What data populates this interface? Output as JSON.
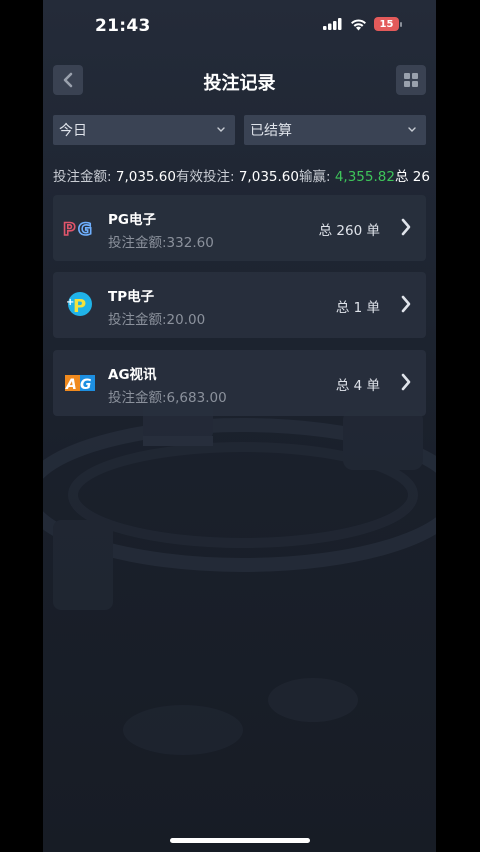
{
  "status_bar": {
    "time": "21:43",
    "battery_level": "15",
    "icons": [
      "cellular-signal-icon",
      "wifi-icon",
      "battery-icon"
    ]
  },
  "header": {
    "title": "投注记录",
    "back_icon": "chevron-left-icon",
    "menu_icon": "grid-icon"
  },
  "filters": {
    "date": {
      "value": "今日"
    },
    "status": {
      "value": "已结算"
    }
  },
  "summary": {
    "bet_label": "投注金额:",
    "bet_value": "7,035.60",
    "valid_label": "有效投注:",
    "valid_value": "7,035.60",
    "winloss_label": "输赢:",
    "winloss_value": "4,355.82",
    "total_label": "总 26"
  },
  "records": [
    {
      "name": "PG电子",
      "amount": "投注金额:332.60",
      "count": "总 260 单",
      "logo": "pg-logo-icon"
    },
    {
      "name": "TP电子",
      "amount": "投注金额:20.00",
      "count": "总 1 单",
      "logo": "tp-logo-icon"
    },
    {
      "name": "AG视讯",
      "amount": "投注金额:6,683.00",
      "count": "总 4 单",
      "logo": "ag-logo-icon"
    }
  ],
  "colors": {
    "background": "#1f2633",
    "card": "#282f3d",
    "filter": "#3a4354",
    "win": "#3ec45a",
    "battery": "#e35a5a"
  }
}
